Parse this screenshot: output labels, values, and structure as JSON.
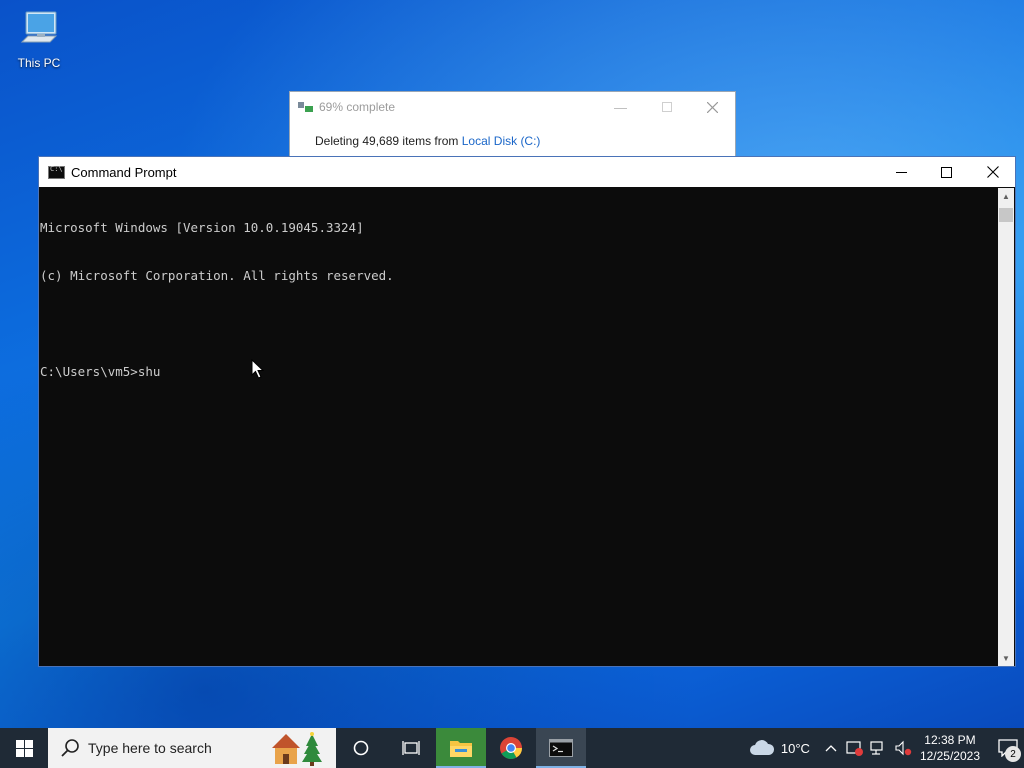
{
  "desktop": {
    "icons": [
      {
        "label": "This PC"
      }
    ]
  },
  "progress_dialog": {
    "title": "69% complete",
    "progress_percent": 69,
    "message_prefix": "Deleting 49,689 items from",
    "location_link": "Local Disk (C:)"
  },
  "cmd_window": {
    "title": "Command Prompt",
    "lines": [
      "Microsoft Windows [Version 10.0.19045.3324]",
      "(c) Microsoft Corporation. All rights reserved.",
      "",
      "C:\\Users\\vm5>shu"
    ]
  },
  "taskbar": {
    "search_placeholder": "Type here to search",
    "weather": {
      "temp": "10°C",
      "icon": "cloud-icon"
    },
    "clock": {
      "time": "12:38 PM",
      "date": "12/25/2023"
    },
    "notification_count": "2",
    "pinned": [
      {
        "name": "cortana",
        "icon": "circle-icon"
      },
      {
        "name": "task-view",
        "icon": "task-view-icon"
      },
      {
        "name": "file-explorer",
        "icon": "folder-icon",
        "active": true
      },
      {
        "name": "chrome",
        "icon": "chrome-icon",
        "active": false
      },
      {
        "name": "command-prompt",
        "icon": "cmd-icon",
        "active": true
      }
    ]
  }
}
